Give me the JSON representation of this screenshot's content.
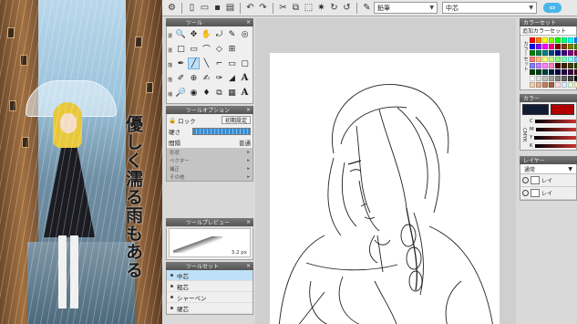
{
  "artwork": {
    "vertical_text": "優しく濡る雨もある"
  },
  "toolbar": {
    "icons": [
      "gear-icon",
      "new-icon",
      "open-icon",
      "save-icon",
      "print-icon",
      "undo-icon",
      "redo-icon",
      "cut-icon",
      "copy-icon",
      "paste-icon",
      "select-icon",
      "transform-icon",
      "rotate-icon",
      "pen-icon"
    ],
    "brush_select": "鉛筆",
    "size_select": "中芯",
    "toggle_label": "⇔"
  },
  "tool_panel": {
    "title": "ツール",
    "categories": [
      "選",
      "選",
      "描",
      "描",
      "補"
    ],
    "rows": [
      [
        "🔍",
        "✥",
        "✋",
        "⤾",
        "✎",
        "◎"
      ],
      [
        "□",
        "▭",
        "⌒",
        "◇",
        "⊞",
        ""
      ],
      [
        "✒",
        "╱",
        "╲",
        "⌐",
        "▭",
        "▢"
      ],
      [
        "✐",
        "⊕",
        "✍",
        "✑",
        "◢",
        "A"
      ],
      [
        "🔎",
        "◉",
        "♦",
        "⧉",
        "▦",
        "A"
      ]
    ],
    "active_row": 2,
    "active_col": 1
  },
  "tool_options": {
    "title": "ツールオプション",
    "lock_label": "ロック",
    "reset_label": "初期設定",
    "hardness_label": "硬さ",
    "spacing_label": "間隔",
    "spacing_value": "普通",
    "shape_label": "形状",
    "vector_label": "ベクター",
    "correction_label": "補正",
    "other_label": "その他"
  },
  "tool_preview": {
    "title": "ツールプレビュー",
    "size": "3.2 px"
  },
  "tool_set": {
    "title": "ツールセット",
    "items": [
      "中芯",
      "粗芯",
      "シャーペン",
      "硬芯"
    ],
    "active_index": 0
  },
  "colors": {
    "panel_title": "カラーセット",
    "set_name": "追加カラーセット",
    "palette_vlabel": "カラーセット",
    "mixer_title": "カラー",
    "mixer_vlabel": "CMYK",
    "channels": [
      "C",
      "M",
      "Y",
      "K"
    ],
    "main_color": "#111a33",
    "sub_color": "#b00000",
    "swatches": [
      "#ff0000",
      "#ff8000",
      "#ffff00",
      "#80ff00",
      "#00ff00",
      "#00ff80",
      "#00ffff",
      "#0080ff",
      "#0000ff",
      "#8000ff",
      "#ff00ff",
      "#ff0080",
      "#800000",
      "#804000",
      "#808000",
      "#408000",
      "#008000",
      "#008040",
      "#008080",
      "#004080",
      "#000080",
      "#400080",
      "#800080",
      "#800040",
      "#ff8080",
      "#ffc080",
      "#ffff80",
      "#c0ff80",
      "#80ff80",
      "#80ffc0",
      "#80ffff",
      "#80c0ff",
      "#8080ff",
      "#c080ff",
      "#ff80ff",
      "#ff80c0",
      "#400000",
      "#402000",
      "#404000",
      "#204000",
      "#004000",
      "#004020",
      "#004040",
      "#002040",
      "#000040",
      "#200040",
      "#400040",
      "#400020",
      "#ffffff",
      "#e0e0e0",
      "#c0c0c0",
      "#a0a0a0",
      "#808080",
      "#606060",
      "#404040",
      "#000000",
      "#f2d0b0",
      "#e0b090",
      "#c08060",
      "#a06040",
      "#ffe0e0",
      "#e0f0ff",
      "#e0ffe0",
      "#fff0c0"
    ]
  },
  "layers": {
    "title": "レイヤー",
    "blend_mode": "通常",
    "rows": [
      "レイ",
      "レイ"
    ]
  }
}
